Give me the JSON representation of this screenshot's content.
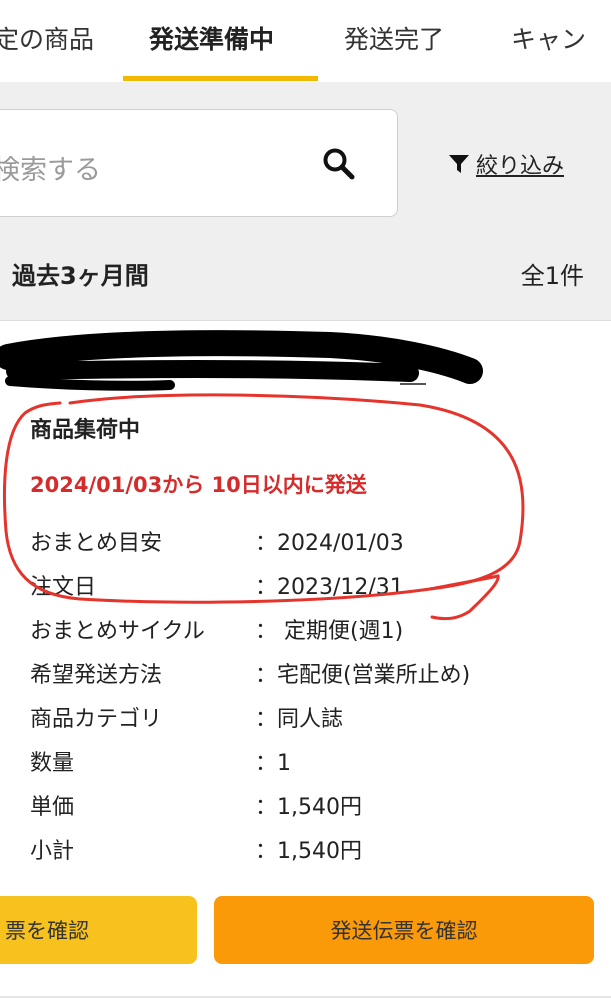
{
  "tabs": [
    {
      "label": "定の商品"
    },
    {
      "label": "発送準備中"
    },
    {
      "label": "発送完了"
    },
    {
      "label": "キャン"
    }
  ],
  "search": {
    "placeholder": "検索する",
    "filter_label": "絞り込み"
  },
  "results": {
    "period": "過去3ヶ月間",
    "count": "全1件"
  },
  "order": {
    "status": "商品集荷中",
    "ship_notice": "2024/01/03から 10日以内に発送",
    "details": [
      {
        "label": "おまとめ目安",
        "value": "：2024/01/03"
      },
      {
        "label": "注文日",
        "value": "：2023/12/31"
      },
      {
        "label": "おまとめサイクル",
        "value": "： 定期便(週1)"
      },
      {
        "label": "希望発送方法",
        "value": "：宅配便(営業所止め)"
      },
      {
        "label": "商品カテゴリ",
        "value": "：同人誌"
      },
      {
        "label": "数量",
        "value": "：1"
      },
      {
        "label": "単価",
        "value": "：1,540円"
      },
      {
        "label": "小計",
        "value": "：1,540円"
      }
    ],
    "buttons": {
      "left": "票を確認",
      "right": "発送伝票を確認"
    }
  },
  "colors": {
    "tab_indicator": "#f5b800",
    "notice_red": "#d62b2b",
    "button_yellow": "#f7c21e",
    "button_orange": "#fb9a09",
    "annotation_red": "#e5342c"
  }
}
